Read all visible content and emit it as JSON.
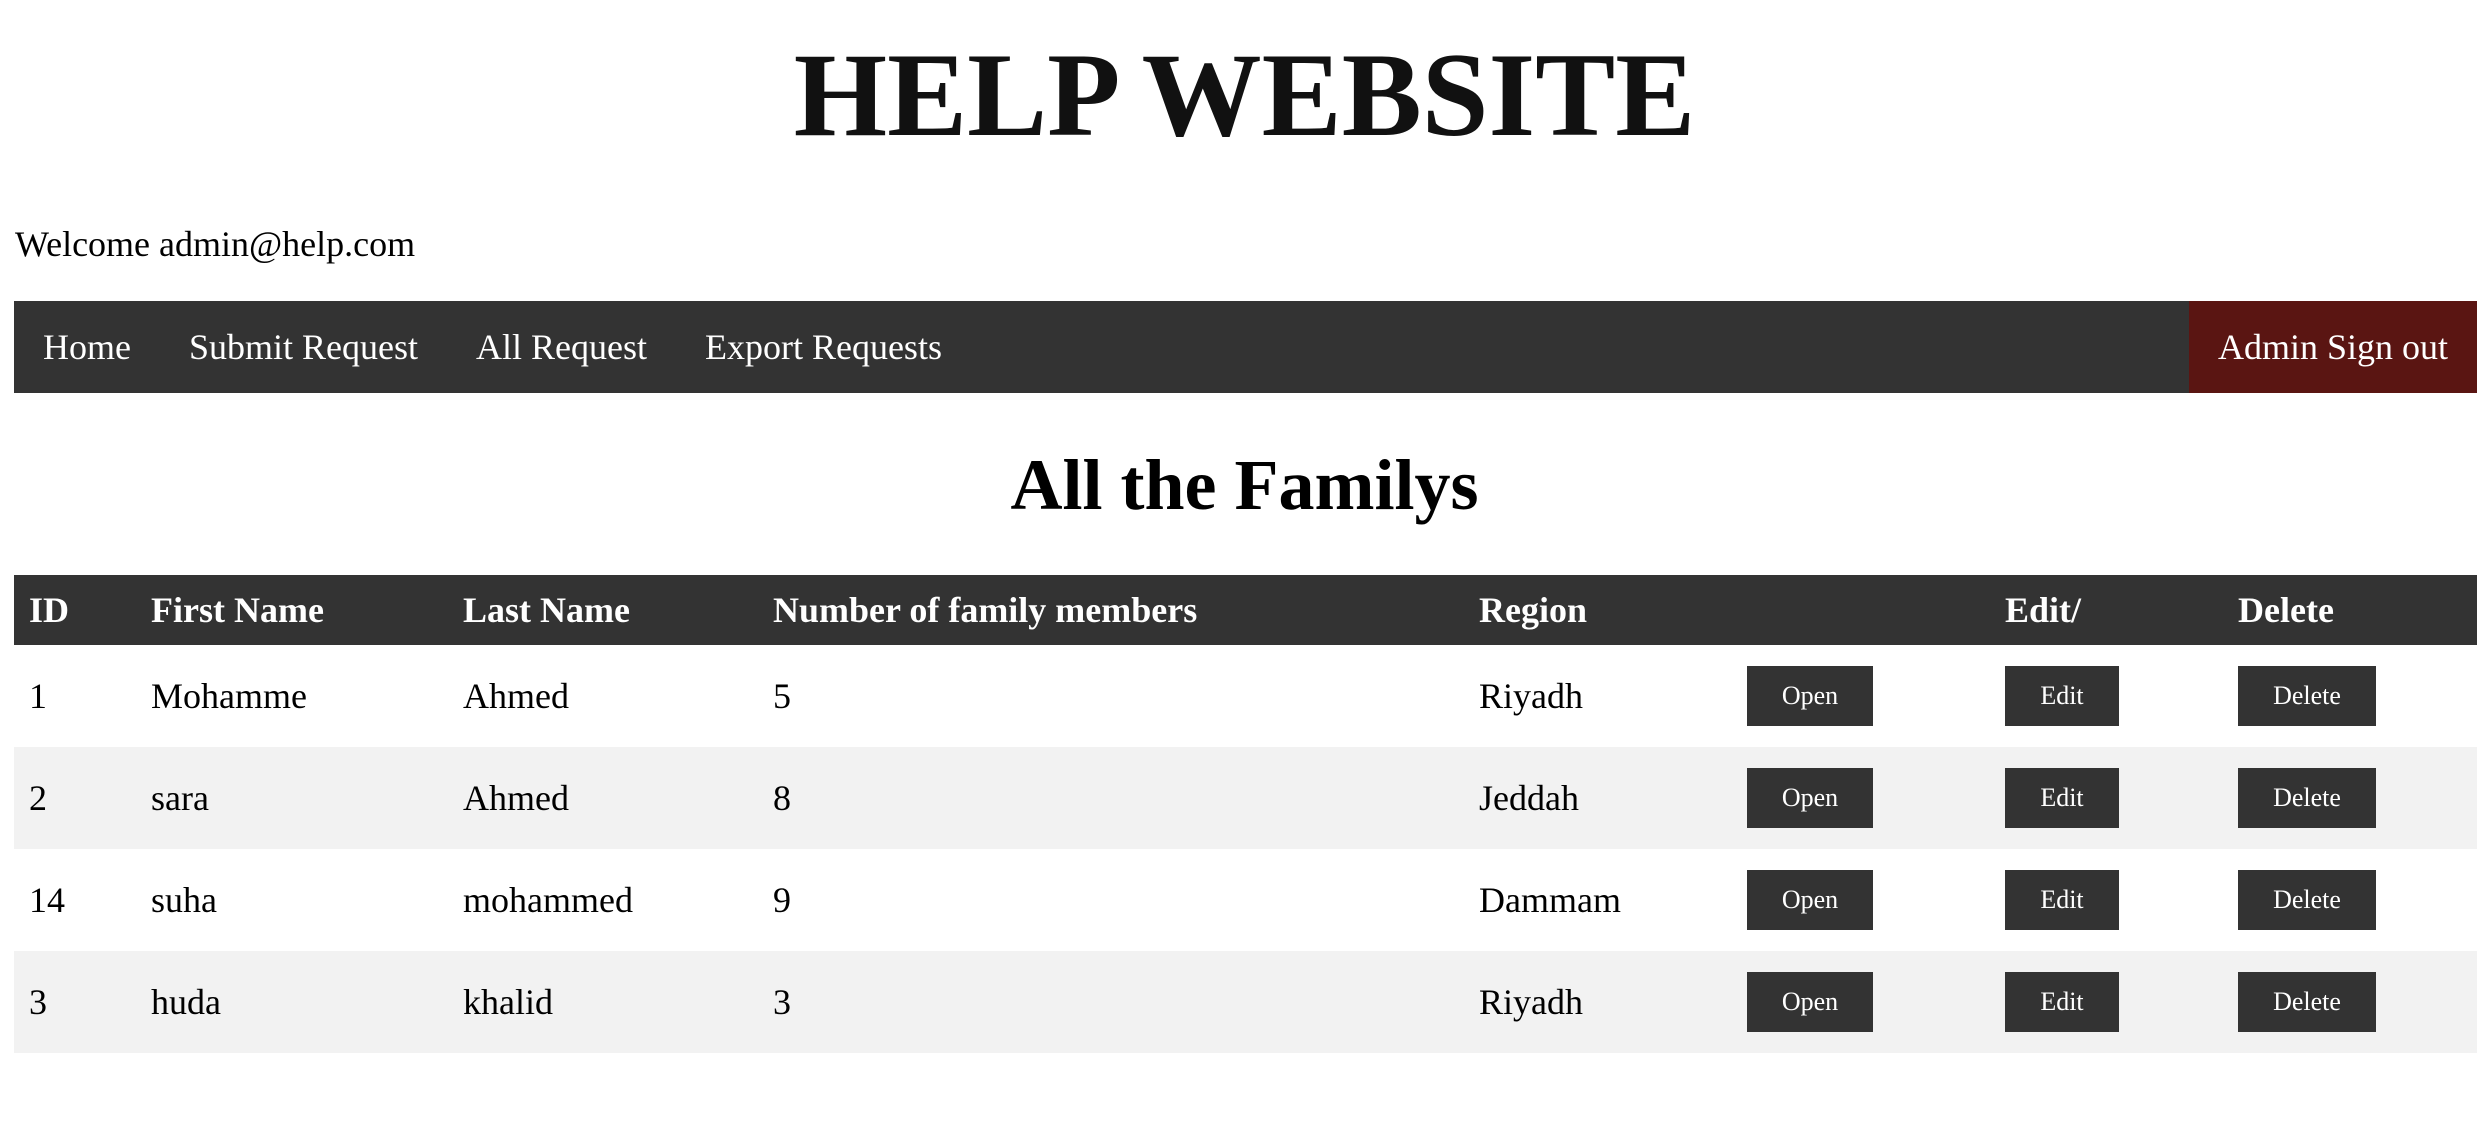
{
  "site": {
    "title": "HELP WEBSITE",
    "welcome_prefix": "Welcome ",
    "user_email": "admin@help.com"
  },
  "nav": {
    "items": [
      {
        "label": "Home"
      },
      {
        "label": "Submit Request"
      },
      {
        "label": "All Request"
      },
      {
        "label": "Export Requests"
      }
    ],
    "signout_label": "Admin Sign out"
  },
  "page": {
    "heading": "All the Familys"
  },
  "table": {
    "columns": [
      "ID",
      "First Name",
      "Last Name",
      "Number of family members",
      "Region",
      "",
      "Edit/",
      "Delete"
    ],
    "rows": [
      {
        "id": "1",
        "first_name": "Mohamme",
        "last_name": "Ahmed",
        "members": "5",
        "region": "Riyadh"
      },
      {
        "id": "2",
        "first_name": "sara",
        "last_name": "Ahmed",
        "members": "8",
        "region": "Jeddah"
      },
      {
        "id": "14",
        "first_name": "suha",
        "last_name": "mohammed",
        "members": "9",
        "region": "Dammam"
      },
      {
        "id": "3",
        "first_name": "huda",
        "last_name": "khalid",
        "members": "3",
        "region": "Riyadh"
      }
    ],
    "actions": {
      "open_label": "Open",
      "edit_label": "Edit",
      "delete_label": "Delete"
    }
  },
  "colors": {
    "nav_background": "#333333",
    "signout_background": "#5a1512",
    "row_alt_background": "#f2f2f2"
  }
}
